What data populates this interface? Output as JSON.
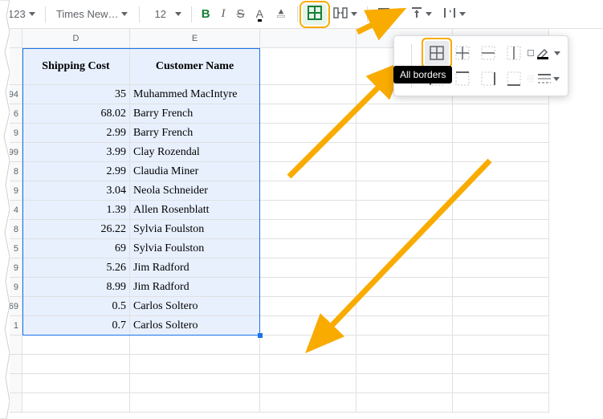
{
  "toolbar": {
    "number_format_label": "123",
    "font_name": "Times New…",
    "font_size": "12",
    "bold": "B",
    "italic": "I",
    "strike": "S",
    "text_color": "A",
    "fill_color": "🞍"
  },
  "tooltip_text": "All borders",
  "columns": {
    "D": "D",
    "E": "E",
    "F": "",
    "G": "",
    "H": ""
  },
  "headers": {
    "col_d": "Shipping Cost",
    "col_e": "Customer Name"
  },
  "row_stubs": [
    ".94",
    "6",
    "9",
    "99",
    "8",
    "9",
    "4",
    "8",
    "5",
    "9",
    "9",
    "69",
    "1"
  ],
  "rows": [
    {
      "cost": "35",
      "name": "Muhammed MacIntyre"
    },
    {
      "cost": "68.02",
      "name": "Barry French"
    },
    {
      "cost": "2.99",
      "name": "Barry French"
    },
    {
      "cost": "3.99",
      "name": "Clay Rozendal"
    },
    {
      "cost": "2.99",
      "name": "Claudia Miner"
    },
    {
      "cost": "3.04",
      "name": "Neola Schneider"
    },
    {
      "cost": "1.39",
      "name": "Allen Rosenblatt"
    },
    {
      "cost": "26.22",
      "name": "Sylvia Foulston"
    },
    {
      "cost": "69",
      "name": "Sylvia Foulston"
    },
    {
      "cost": "5.26",
      "name": "Jim Radford"
    },
    {
      "cost": "8.99",
      "name": "Jim Radford"
    },
    {
      "cost": "0.5",
      "name": "Carlos Soltero"
    },
    {
      "cost": "0.7",
      "name": "Carlos Soltero"
    }
  ]
}
